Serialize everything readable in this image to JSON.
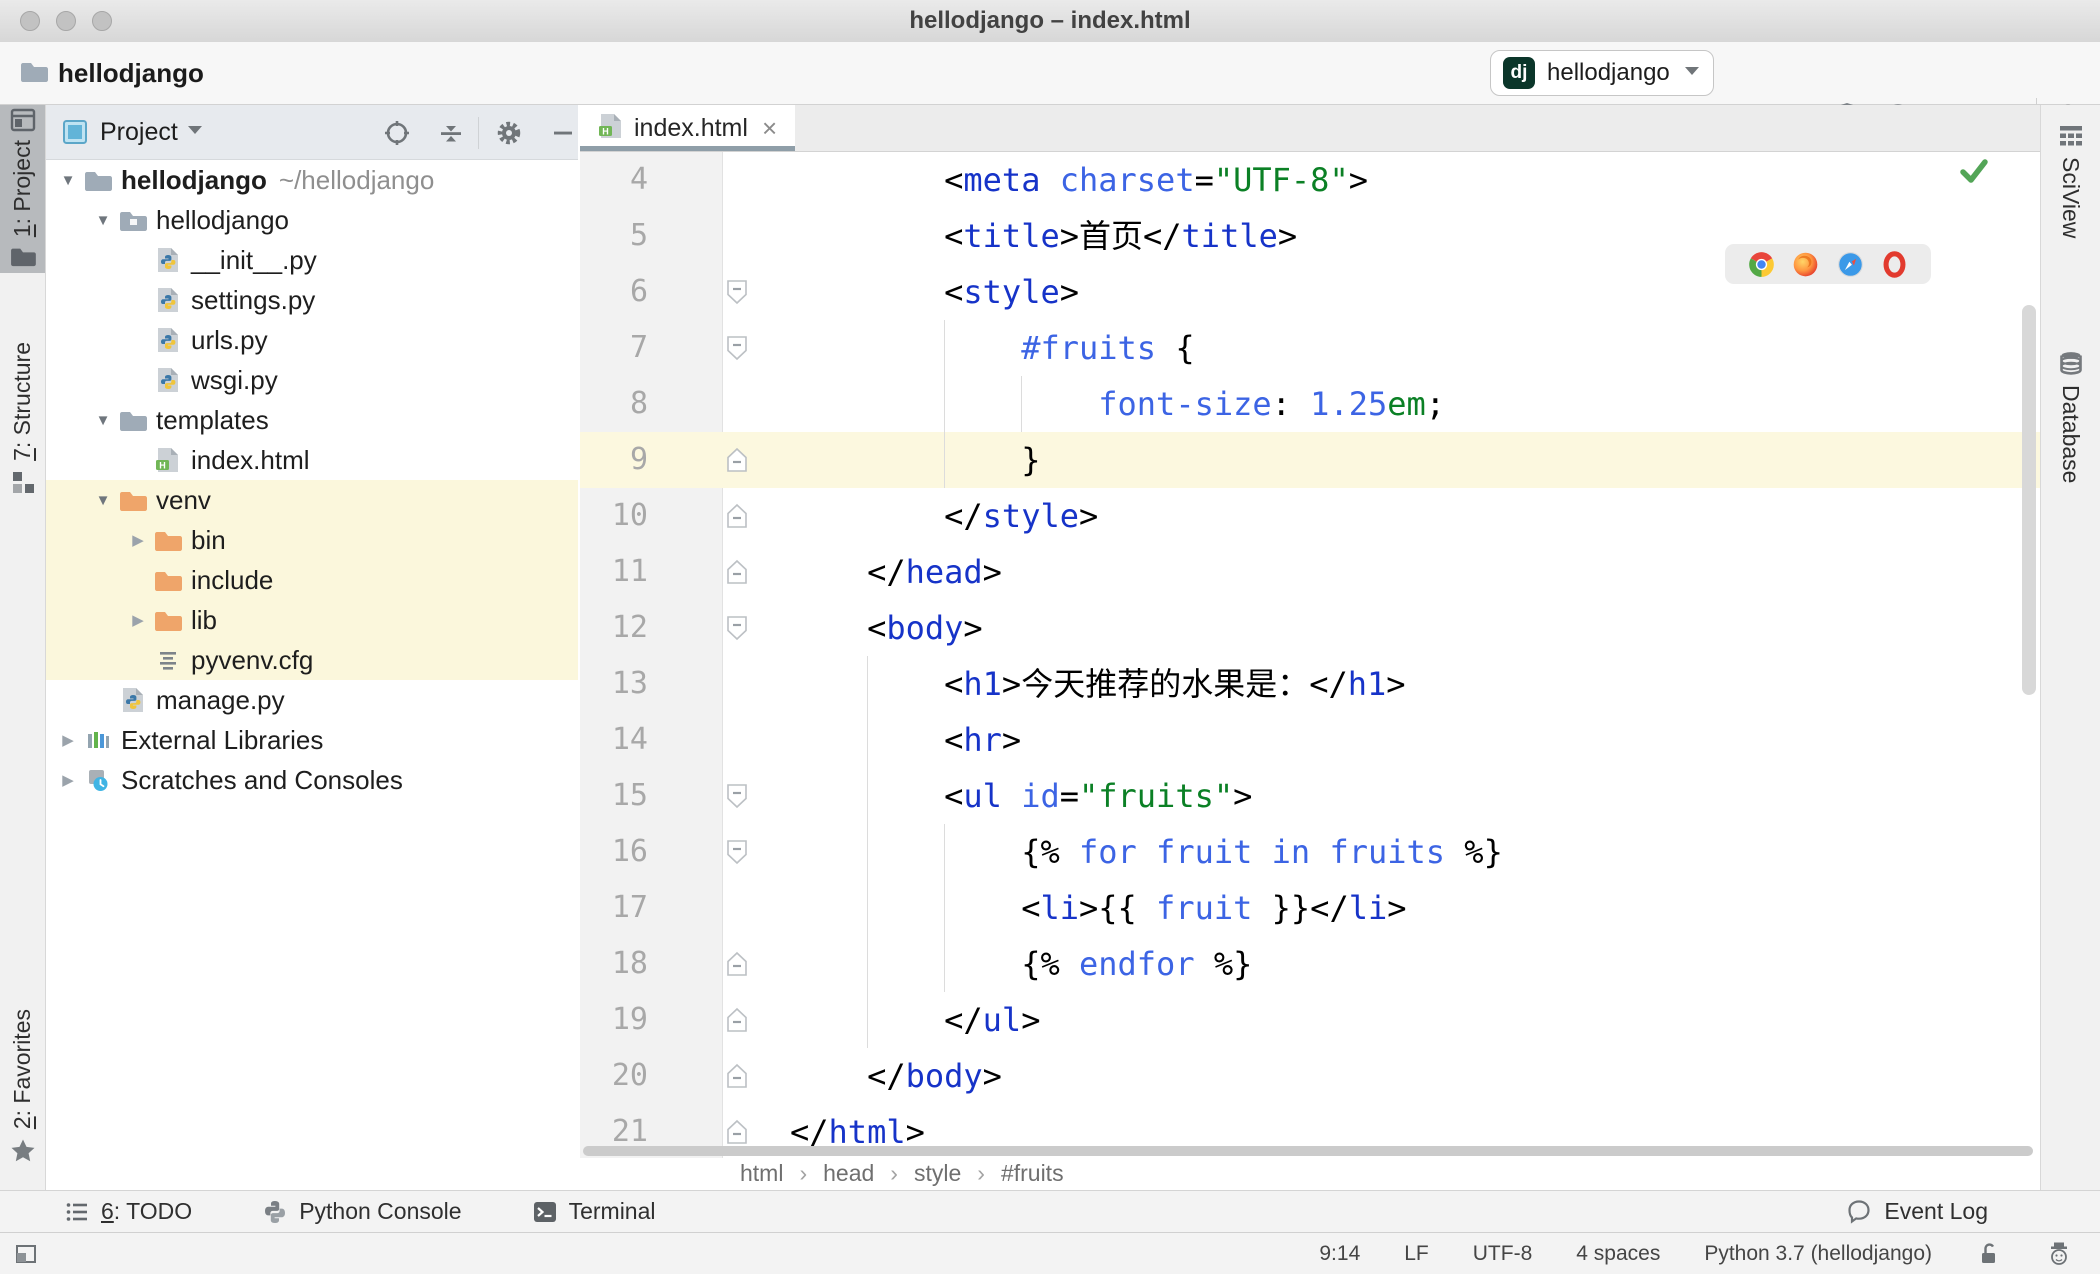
{
  "window": {
    "title": "hellodjango – index.html"
  },
  "toolbar": {
    "breadcrumb": "hellodjango",
    "run_config": {
      "badge": "dj",
      "name": "hellodjango"
    },
    "actions": [
      "run",
      "debug",
      "run-coverage",
      "profile",
      "run-concurrency",
      "stop"
    ],
    "search": "search"
  },
  "left_strip": {
    "buttons": [
      {
        "label": "1: Project",
        "active": true
      },
      {
        "label": "7: Structure",
        "active": false
      },
      {
        "label": "2: Favorites",
        "active": false
      }
    ]
  },
  "right_strip": {
    "buttons": [
      {
        "label": "SciView"
      },
      {
        "label": "Database"
      }
    ]
  },
  "project_panel": {
    "title": "Project",
    "header_icons": [
      "locate",
      "collapse-all",
      "settings",
      "hide"
    ],
    "tree": [
      {
        "label": "hellodjango",
        "path": "~/hellodjango",
        "level": 0,
        "icon": "folder",
        "arrow": "open",
        "bold": true,
        "hl": false
      },
      {
        "label": "hellodjango",
        "path": "",
        "level": 1,
        "icon": "package",
        "arrow": "open",
        "bold": false,
        "hl": false
      },
      {
        "label": "__init__.py",
        "path": "",
        "level": 2,
        "icon": "python-file",
        "arrow": null,
        "bold": false,
        "hl": false
      },
      {
        "label": "settings.py",
        "path": "",
        "level": 2,
        "icon": "python-file",
        "arrow": null,
        "bold": false,
        "hl": false
      },
      {
        "label": "urls.py",
        "path": "",
        "level": 2,
        "icon": "python-file",
        "arrow": null,
        "bold": false,
        "hl": false
      },
      {
        "label": "wsgi.py",
        "path": "",
        "level": 2,
        "icon": "python-file",
        "arrow": null,
        "bold": false,
        "hl": false
      },
      {
        "label": "templates",
        "path": "",
        "level": 1,
        "icon": "folder",
        "arrow": "open",
        "bold": false,
        "hl": false
      },
      {
        "label": "index.html",
        "path": "",
        "level": 2,
        "icon": "html-file",
        "arrow": null,
        "bold": false,
        "hl": false
      },
      {
        "label": "venv",
        "path": "",
        "level": 1,
        "icon": "folder-ex",
        "arrow": "open",
        "bold": false,
        "hl": true
      },
      {
        "label": "bin",
        "path": "",
        "level": 2,
        "icon": "folder-ex",
        "arrow": "closed",
        "bold": false,
        "hl": true
      },
      {
        "label": "include",
        "path": "",
        "level": 2,
        "icon": "folder-ex",
        "arrow": null,
        "bold": false,
        "hl": true
      },
      {
        "label": "lib",
        "path": "",
        "level": 2,
        "icon": "folder-ex",
        "arrow": "closed",
        "bold": false,
        "hl": true
      },
      {
        "label": "pyvenv.cfg",
        "path": "",
        "level": 2,
        "icon": "text-file",
        "arrow": null,
        "bold": false,
        "hl": true
      },
      {
        "label": "manage.py",
        "path": "",
        "level": 1,
        "icon": "python-file",
        "arrow": null,
        "bold": false,
        "hl": false
      },
      {
        "label": "External Libraries",
        "path": "",
        "level": 0,
        "icon": "libs",
        "arrow": "closed",
        "bold": false,
        "hl": false
      },
      {
        "label": "Scratches and Consoles",
        "path": "",
        "level": 0,
        "icon": "scratch",
        "arrow": "closed",
        "bold": false,
        "hl": false
      }
    ]
  },
  "editor": {
    "tab": "index.html",
    "breadcrumbs": [
      "html",
      "head",
      "style",
      "#fruits"
    ],
    "browser_icons": [
      "chrome",
      "firefox",
      "safari",
      "opera"
    ],
    "indent_guides": [
      {
        "col": 8,
        "from": 7,
        "to": 9
      },
      {
        "col": 12,
        "from": 8,
        "to": 8
      },
      {
        "col": 4,
        "from": 13,
        "to": 19
      },
      {
        "col": 8,
        "from": 16,
        "to": 18
      }
    ],
    "lines": [
      {
        "num": 4,
        "fold": null,
        "hl": false,
        "seg": [
          [
            "cn",
            "        <"
          ],
          [
            "ct",
            "meta"
          ],
          [
            "cn",
            " "
          ],
          [
            "ck",
            "charset"
          ],
          [
            "cn",
            "="
          ],
          [
            "cs",
            "\"UTF-8\""
          ],
          [
            "cn",
            ">"
          ]
        ]
      },
      {
        "num": 5,
        "fold": null,
        "hl": false,
        "seg": [
          [
            "cn",
            "        <"
          ],
          [
            "ct",
            "title"
          ],
          [
            "cn",
            ">首页</"
          ],
          [
            "ct",
            "title"
          ],
          [
            "cn",
            ">"
          ]
        ]
      },
      {
        "num": 6,
        "fold": "open",
        "hl": false,
        "seg": [
          [
            "cn",
            "        <"
          ],
          [
            "ct",
            "style"
          ],
          [
            "cn",
            ">"
          ]
        ]
      },
      {
        "num": 7,
        "fold": "open",
        "hl": false,
        "seg": [
          [
            "cn",
            "            "
          ],
          [
            "ck",
            "#fruits"
          ],
          [
            "cn",
            " {"
          ]
        ]
      },
      {
        "num": 8,
        "fold": null,
        "hl": false,
        "seg": [
          [
            "cn",
            "                "
          ],
          [
            "ck",
            "font-size"
          ],
          [
            "cn",
            ": "
          ],
          [
            "ck",
            "1.25"
          ],
          [
            "cs",
            "em"
          ],
          [
            "cn",
            ";"
          ]
        ]
      },
      {
        "num": 9,
        "fold": "close",
        "hl": true,
        "seg": [
          [
            "cn",
            "            }"
          ]
        ]
      },
      {
        "num": 10,
        "fold": "close",
        "hl": false,
        "seg": [
          [
            "cn",
            "        </"
          ],
          [
            "ct",
            "style"
          ],
          [
            "cn",
            ">"
          ]
        ]
      },
      {
        "num": 11,
        "fold": "close",
        "hl": false,
        "seg": [
          [
            "cn",
            "    </"
          ],
          [
            "ct",
            "head"
          ],
          [
            "cn",
            ">"
          ]
        ]
      },
      {
        "num": 12,
        "fold": "open",
        "hl": false,
        "seg": [
          [
            "cn",
            "    <"
          ],
          [
            "ct",
            "body"
          ],
          [
            "cn",
            ">"
          ]
        ]
      },
      {
        "num": 13,
        "fold": null,
        "hl": false,
        "seg": [
          [
            "cn",
            "        <"
          ],
          [
            "ct",
            "h1"
          ],
          [
            "cn",
            ">今天推荐的水果是：</"
          ],
          [
            "ct",
            "h1"
          ],
          [
            "cn",
            ">"
          ]
        ]
      },
      {
        "num": 14,
        "fold": null,
        "hl": false,
        "seg": [
          [
            "cn",
            "        <"
          ],
          [
            "ct",
            "hr"
          ],
          [
            "cn",
            ">"
          ]
        ]
      },
      {
        "num": 15,
        "fold": "open",
        "hl": false,
        "seg": [
          [
            "cn",
            "        <"
          ],
          [
            "ct",
            "ul"
          ],
          [
            "cn",
            " "
          ],
          [
            "ck",
            "id"
          ],
          [
            "cn",
            "="
          ],
          [
            "cs",
            "\"fruits\""
          ],
          [
            "cn",
            ">"
          ]
        ]
      },
      {
        "num": 16,
        "fold": "open",
        "hl": false,
        "seg": [
          [
            "cn",
            "            {% "
          ],
          [
            "ck",
            "for fruit in fruits"
          ],
          [
            "cn",
            " %}"
          ]
        ]
      },
      {
        "num": 17,
        "fold": null,
        "hl": false,
        "seg": [
          [
            "cn",
            "            <"
          ],
          [
            "ct",
            "li"
          ],
          [
            "cn",
            ">{{ "
          ],
          [
            "ck",
            "fruit"
          ],
          [
            "cn",
            " }}</"
          ],
          [
            "ct",
            "li"
          ],
          [
            "cn",
            ">"
          ]
        ]
      },
      {
        "num": 18,
        "fold": "close",
        "hl": false,
        "seg": [
          [
            "cn",
            "            {% "
          ],
          [
            "ck",
            "endfor"
          ],
          [
            "cn",
            " %}"
          ]
        ]
      },
      {
        "num": 19,
        "fold": "close",
        "hl": false,
        "seg": [
          [
            "cn",
            "        </"
          ],
          [
            "ct",
            "ul"
          ],
          [
            "cn",
            ">"
          ]
        ]
      },
      {
        "num": 20,
        "fold": "close",
        "hl": false,
        "seg": [
          [
            "cn",
            "    </"
          ],
          [
            "ct",
            "body"
          ],
          [
            "cn",
            ">"
          ]
        ]
      },
      {
        "num": 21,
        "fold": "close",
        "hl": false,
        "seg": [
          [
            "cn",
            "</"
          ],
          [
            "ct",
            "html"
          ],
          [
            "cn",
            ">"
          ]
        ]
      }
    ]
  },
  "tool_buttons": {
    "left": [
      {
        "label": "6: TODO",
        "icon": "todo",
        "underline_first": true
      },
      {
        "label": "Python Console",
        "icon": "python-logo",
        "underline_first": false
      },
      {
        "label": "Terminal",
        "icon": "terminal",
        "underline_first": false
      }
    ],
    "right": [
      {
        "label": "Event Log",
        "icon": "bell",
        "underline_first": false
      }
    ]
  },
  "status_bar": {
    "items": [
      "9:14",
      "LF",
      "UTF-8",
      "4 spaces",
      "Python 3.7 (hellodjango)"
    ],
    "icons": [
      "unlock",
      "hector"
    ]
  },
  "colors": {
    "accent_green": "#4da153",
    "django_badge_green": "#0b362a",
    "excluded_folder_orange": "#efa56a",
    "folder_gray": "#9fabb7",
    "tree_highlight": "#fbf7dc",
    "line_highlight": "#fcf8df",
    "tag_blue": "#1633c8",
    "keyword_blue": "#3c64e4",
    "string_green": "#0b8025",
    "tab_underline": "#8f9ea8"
  }
}
